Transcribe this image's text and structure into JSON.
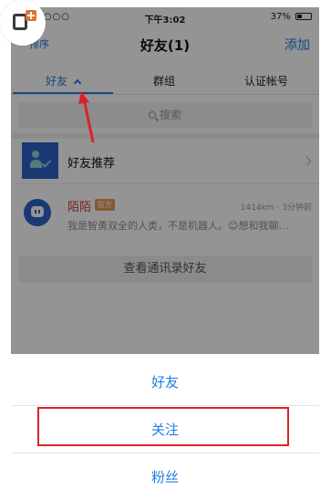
{
  "status_bar": {
    "carrier": "••○○○",
    "time": "下午3:02",
    "battery_percent": "37%"
  },
  "nav": {
    "left": "排序",
    "title": "好友(1)",
    "right": "添加"
  },
  "tabs": [
    {
      "label": "好友",
      "active": true
    },
    {
      "label": "群组",
      "active": false
    },
    {
      "label": "认证帐号",
      "active": false
    }
  ],
  "search": {
    "placeholder": "搜索"
  },
  "recommend": {
    "label": "好友推荐"
  },
  "contact": {
    "name": "陌陌",
    "badge": "官方",
    "meta": "1414km · 3分钟前",
    "message": "我是智勇双全的人类，不是机器人。😊想和我聊…"
  },
  "contacts_button": "查看通讯录好友",
  "sheet": {
    "items": [
      "好友",
      "关注",
      "粉丝"
    ],
    "highlighted_index": 1
  },
  "colors": {
    "accent": "#2080e0",
    "annotation_red": "#d9232a",
    "brand_blue": "#2c63c9"
  }
}
